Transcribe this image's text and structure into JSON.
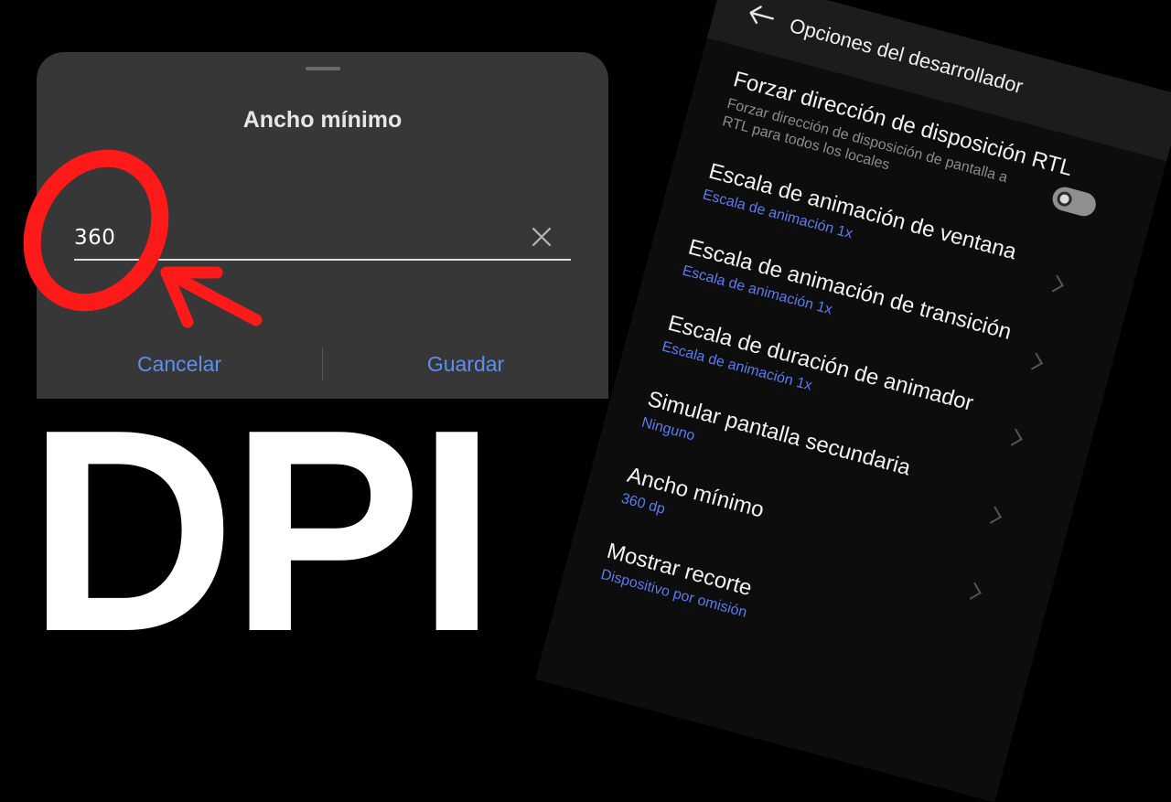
{
  "dialog": {
    "title": "Ancho mínimo",
    "input_value": "360",
    "cancel_label": "Cancelar",
    "save_label": "Guardar"
  },
  "overlay_text": "DPI",
  "settings_screen": {
    "title": "Opciones del desarrollador",
    "items": [
      {
        "title": "Forzar dirección de disposición RTL",
        "description": "Forzar dirección de disposición de pantalla a RTL para todos los locales",
        "control": "toggle"
      },
      {
        "title": "Escala de animación de ventana",
        "value": "Escala de animación 1x"
      },
      {
        "title": "Escala de animación de transición",
        "value": "Escala de animación 1x"
      },
      {
        "title": "Escala de duración de animador",
        "value": "Escala de animación 1x"
      },
      {
        "title": "Simular pantalla secundaria",
        "value": "Ninguno"
      },
      {
        "title": "Ancho mínimo",
        "value": "360 dp"
      },
      {
        "title": "Mostrar recorte",
        "value": "Dispositivo por omisión"
      }
    ]
  },
  "colors": {
    "accent": "#5b8ff2",
    "annotation": "#ff1a1a",
    "dialog_bg": "#373737"
  }
}
